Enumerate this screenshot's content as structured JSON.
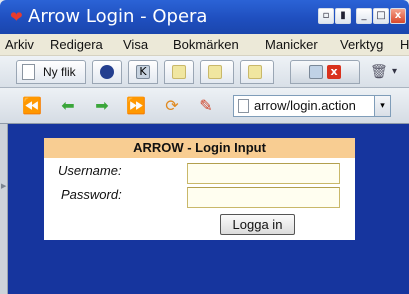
{
  "window": {
    "title": "Arrow Login - Opera",
    "app_icon": "opera-icon",
    "restore_glyph": "▫",
    "minimize_glyph": "_",
    "maximize_glyph": "□",
    "close_glyph": "x"
  },
  "menu": {
    "items": [
      "Arkiv",
      "Redigera",
      "Visa",
      "Bokmärken",
      "Manicker",
      "Verktyg",
      "H"
    ]
  },
  "tabs": {
    "new_tab_label": "Ny flik",
    "trash_glyph": "🗑",
    "trash_dropdown_glyph": "▾"
  },
  "toolbar": {
    "rewind_icon": "rewind-icon",
    "back_icon": "back-arrow-icon",
    "forward_icon": "forward-arrow-icon",
    "fast_forward_icon": "fast-forward-icon",
    "reload_icon": "reload-icon",
    "edit_icon": "wand-icon",
    "address": "arrow/login.action",
    "dropdown_glyph": "▾"
  },
  "login": {
    "header": "ARROW - Login Input",
    "username_label": "Username:",
    "username_value": "",
    "password_label": "Password:",
    "password_value": "",
    "submit_label": "Logga in"
  },
  "colors": {
    "titlebar": "#2b63d6",
    "page_background": "#16359e",
    "login_header": "#f8cd92",
    "input_border": "#c9b86a"
  }
}
